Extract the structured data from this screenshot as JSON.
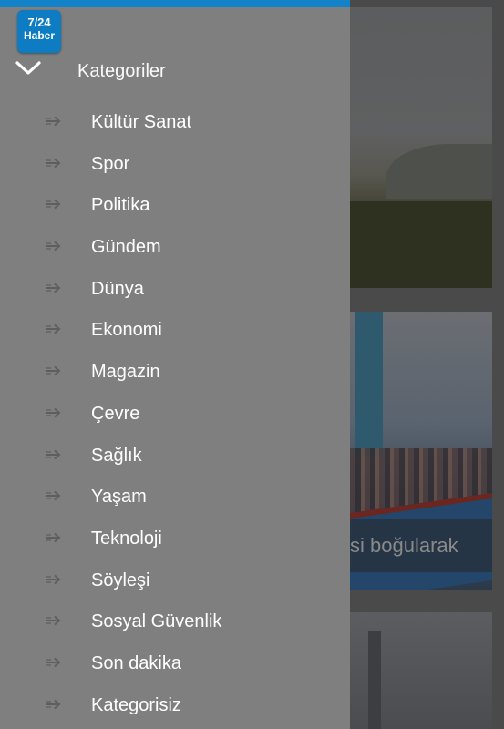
{
  "app": {
    "logo_line1": "7/24",
    "logo_line2": "Haber"
  },
  "drawer": {
    "header_label": "Kategoriler",
    "items": [
      {
        "label": "Kültür Sanat"
      },
      {
        "label": "Spor"
      },
      {
        "label": "Politika"
      },
      {
        "label": "Gündem"
      },
      {
        "label": "Dünya"
      },
      {
        "label": "Ekonomi"
      },
      {
        "label": "Magazin"
      },
      {
        "label": "Çevre"
      },
      {
        "label": "Sağlık"
      },
      {
        "label": "Yaşam"
      },
      {
        "label": "Teknoloji"
      },
      {
        "label": "Söyleşi"
      },
      {
        "label": "Sosyal Güvenlik"
      },
      {
        "label": "Son dakika"
      },
      {
        "label": "Kategorisiz"
      }
    ]
  },
  "background": {
    "card2_caption": "si boğularak"
  },
  "colors": {
    "accent": "#1383c9",
    "drawer_bg": "#7f7f7f",
    "logo_bg": "#0d7cc2"
  }
}
